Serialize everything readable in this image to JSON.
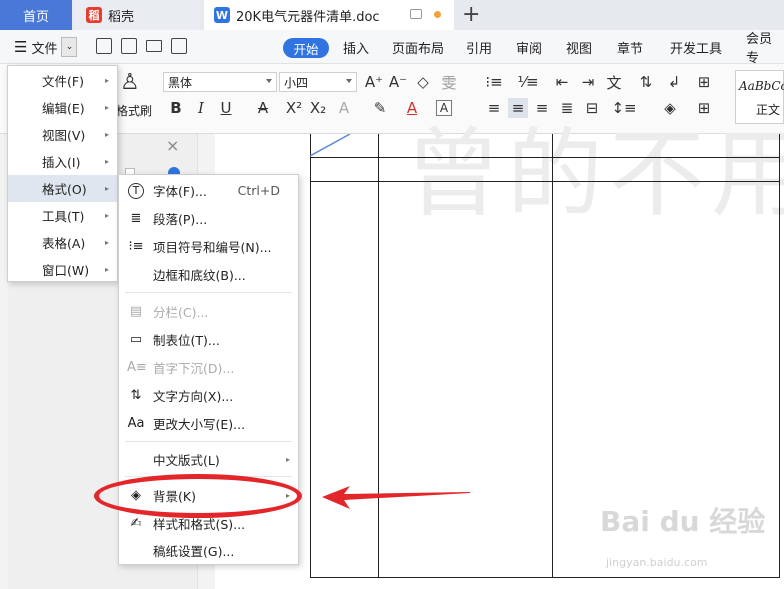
{
  "tabs": {
    "home": "首页",
    "daoke": "稻壳",
    "doc_title": "20K电气元器件清单.doc",
    "new_tab": "+"
  },
  "toolbar": {
    "file_menu": "文件",
    "start": "开始",
    "items": [
      "插入",
      "页面布局",
      "引用",
      "审阅",
      "视图",
      "章节",
      "开发工具",
      "会员专"
    ]
  },
  "ribbon": {
    "font_name": "黑体",
    "font_size": "小四",
    "format_brush": "格式刷",
    "style_sample": "AaBbCc",
    "style_name": "正文"
  },
  "main_menu": {
    "items": [
      {
        "label": "文件(F)"
      },
      {
        "label": "编辑(E)"
      },
      {
        "label": "视图(V)"
      },
      {
        "label": "插入(I)"
      },
      {
        "label": "格式(O)"
      },
      {
        "label": "工具(T)"
      },
      {
        "label": "表格(A)"
      },
      {
        "label": "窗口(W)"
      }
    ]
  },
  "format_menu": {
    "font": "字体(F)...",
    "font_shortcut": "Ctrl+D",
    "paragraph": "段落(P)...",
    "bullets": "项目符号和编号(N)...",
    "borders": "边框和底纹(B)...",
    "columns": "分栏(C)...",
    "tabs": "制表位(T)...",
    "drop_cap": "首字下沉(D)...",
    "text_direction": "文字方向(X)...",
    "change_case": "更改大小写(E)...",
    "chinese_layout": "中文版式(L)",
    "background": "背景(K)",
    "styles": "样式和格式(S)...",
    "manuscript": "稿纸设置(G)..."
  },
  "document": {
    "watermark_text": "曾的不用"
  },
  "branding": {
    "site": "Bai du 经验",
    "url": "jingyan.baidu.com"
  },
  "colors": {
    "accent": "#2f74e0",
    "annotation": "#e3262a",
    "home_tab": "#4a78d8",
    "daoke": "#e63b2e"
  }
}
